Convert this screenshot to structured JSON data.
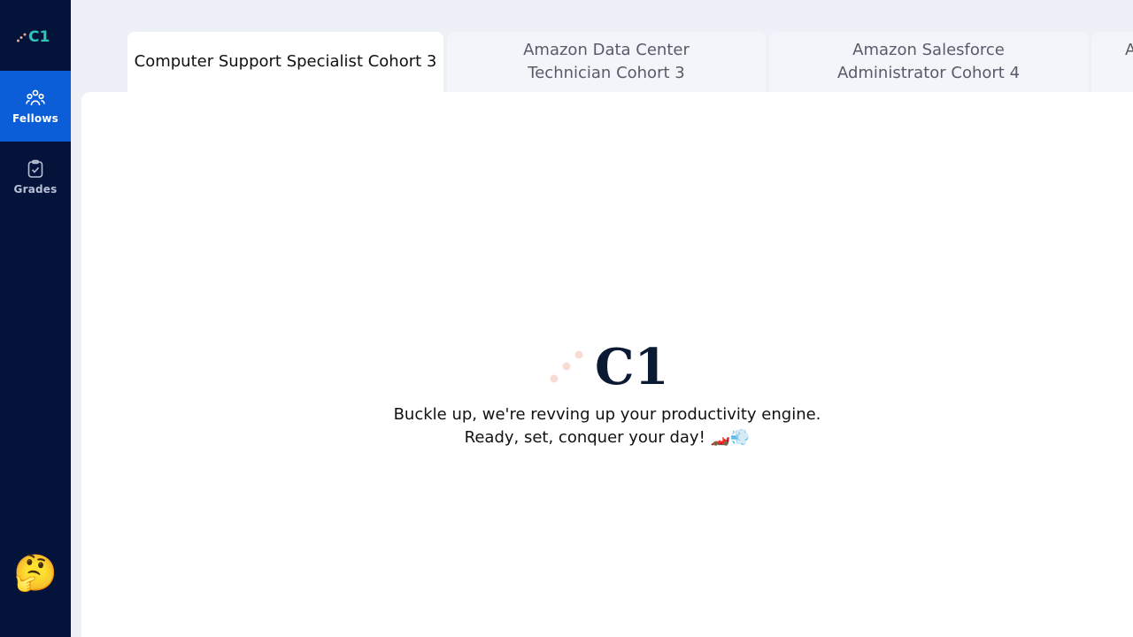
{
  "brand": {
    "logo_text": "C1",
    "accent_color": "#2ec4b6",
    "dots_color": "#f0a68f",
    "dark_color": "#0b1a33"
  },
  "sidebar": {
    "items": [
      {
        "label": "Fellows",
        "icon": "people-group-icon",
        "active": true
      },
      {
        "label": "Grades",
        "icon": "clipboard-check-icon",
        "active": false
      }
    ],
    "avatar_icon": "thinking-face-icon",
    "avatar_glyph": "🤔"
  },
  "tabs": [
    {
      "label": "Computer Support Specialist Cohort 3",
      "active": true
    },
    {
      "label": "Amazon Data Center Technician Cohort 3",
      "active": false
    },
    {
      "label": "Amazon Salesforce Administrator Cohort 4",
      "active": false
    },
    {
      "label": "A",
      "active": false
    }
  ],
  "loader": {
    "logo_text": "C1",
    "line1": "Buckle up, we're revving up your productivity engine.",
    "line2": "Ready, set, conquer your day! 🏎️💨"
  }
}
